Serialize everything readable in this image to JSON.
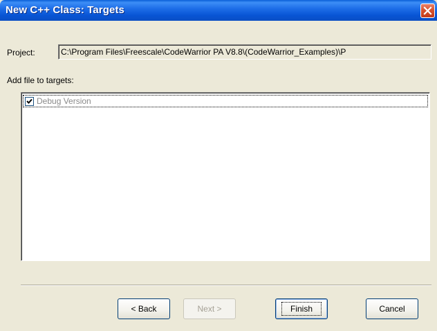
{
  "window": {
    "title": "New C++ Class: Targets"
  },
  "project": {
    "label": "Project:",
    "value": "C:\\Program Files\\Freescale\\CodeWarrior PA V8.8\\(CodeWarrior_Examples)\\P"
  },
  "targets": {
    "label": "Add file to targets:",
    "items": [
      {
        "label": "Debug Version",
        "checked": true
      }
    ]
  },
  "buttons": {
    "back": "< Back",
    "next": "Next >",
    "finish": "Finish",
    "cancel": "Cancel"
  },
  "colors": {
    "titlebar": "#0a5fd8",
    "dialog_bg": "#ece9d8",
    "close_btn": "#d7532e"
  },
  "icons": {
    "close": "close-icon",
    "checkmark": "checkmark-icon"
  }
}
